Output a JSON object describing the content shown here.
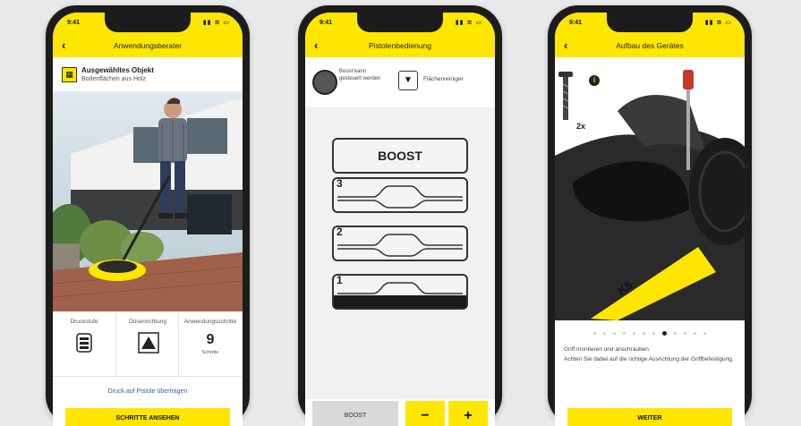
{
  "status": {
    "time": "9:41",
    "icons": "▮▮ ≋ ▭"
  },
  "phone1": {
    "title": "Anwendungsberater",
    "chosen_title": "Ausgewähltes Objekt",
    "chosen_sub": "Bodenflächen aus Holz",
    "params": [
      {
        "label": "Druckstufe",
        "icon": "pressure-gun-icon"
      },
      {
        "label": "Düsenrichtung",
        "icon": "nozzle-spray-icon"
      },
      {
        "label": "Anwendungsschritte",
        "value": "9",
        "unit": "Schritte"
      }
    ],
    "link": "Druck auf Pistole übertragen",
    "button": "SCHRITTE ANSEHEN"
  },
  "phone2": {
    "title": "Pistolenbedienung",
    "dial_text": "Boost kann gesteuert werden",
    "nozzle_text": "Flächenreiniger",
    "boost_label": "BOOST",
    "levels": [
      "3",
      "2",
      "1"
    ],
    "bottom_boost": "BOOST",
    "minus": "−",
    "plus": "+"
  },
  "phone3": {
    "title": "Aufbau des Gerätes",
    "screw_count": "2x",
    "info_icon": "i",
    "brand": "K5",
    "slide_count": 12,
    "active_slide": 8,
    "text_1": "Griff montieren und anschrauben.",
    "text_2": "Achten Sie dabei auf die richtige Ausrichtung der Griffbefestigung.",
    "button": "WEITER"
  },
  "colors": {
    "accent": "#ffe600",
    "dark": "#1c1c1c",
    "link": "#2f5fb3"
  }
}
